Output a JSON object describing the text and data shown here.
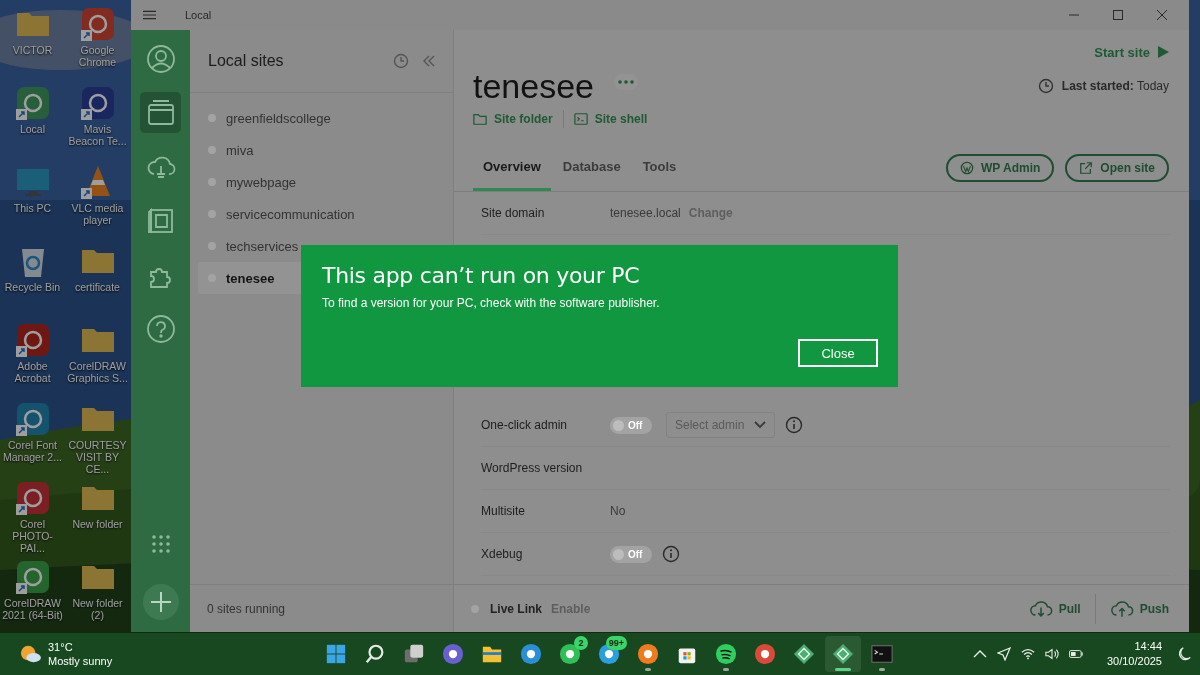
{
  "desktop_icons": [
    {
      "label": "VICTOR",
      "kind": "folder",
      "shortcut": false
    },
    {
      "label": "Google Chrome",
      "kind": "chrome",
      "shortcut": true
    },
    {
      "label": "Local",
      "kind": "local",
      "shortcut": true
    },
    {
      "label": "Mavis Beacon Te...",
      "kind": "mavis",
      "shortcut": true
    },
    {
      "label": "This PC",
      "kind": "monitor",
      "shortcut": false
    },
    {
      "label": "VLC media player",
      "kind": "vlc",
      "shortcut": true
    },
    {
      "label": "Recycle Bin",
      "kind": "recycle",
      "shortcut": false
    },
    {
      "label": "certificate",
      "kind": "folder",
      "shortcut": false
    },
    {
      "label": "Adobe Acrobat",
      "kind": "acrobat",
      "shortcut": true
    },
    {
      "label": "CorelDRAW Graphics S...",
      "kind": "folder",
      "shortcut": false
    },
    {
      "label": "Corel Font Manager 2...",
      "kind": "fontmgr",
      "shortcut": true
    },
    {
      "label": "COURTESY VISIT BY CE...",
      "kind": "folder",
      "shortcut": false
    },
    {
      "label": "Corel PHOTO-PAI...",
      "shortcut": true
    },
    {
      "label": "New folder",
      "kind": "folder",
      "shortcut": false
    },
    {
      "label": "CorelDRAW 2021 (64-Bit)",
      "kind": "draw",
      "shortcut": true
    },
    {
      "label": "New folder (2)",
      "kind": "folder",
      "shortcut": false
    }
  ],
  "window": {
    "title": "Local"
  },
  "nav": {
    "items": [
      {
        "kind": "account",
        "selected": false
      },
      {
        "kind": "sites",
        "selected": true
      },
      {
        "kind": "cloud",
        "selected": false
      },
      {
        "kind": "blueprints",
        "selected": false
      },
      {
        "kind": "addons",
        "selected": false
      },
      {
        "kind": "help",
        "selected": false
      }
    ]
  },
  "sites_panel": {
    "title": "Local sites",
    "sites": [
      {
        "name": "greenfieldscollege",
        "running": false,
        "selected": false
      },
      {
        "name": "miva",
        "running": false,
        "selected": false
      },
      {
        "name": "mywebpage",
        "running": false,
        "selected": false
      },
      {
        "name": "servicecommunication",
        "running": false,
        "selected": false
      },
      {
        "name": "techservices",
        "running": false,
        "selected": false
      },
      {
        "name": "tenesee",
        "running": false,
        "selected": true
      }
    ],
    "footer": "0 sites running"
  },
  "site": {
    "start_label": "Start site",
    "name": "tenesee",
    "last_started": "**Last started:** Today",
    "links": [
      {
        "kind": "folder",
        "label": "Site folder"
      },
      {
        "kind": "shell",
        "label": "Site shell"
      }
    ],
    "tabs": [
      {
        "label": "Overview",
        "selected": true
      },
      {
        "label": "Database",
        "selected": false
      },
      {
        "label": "Tools",
        "selected": false
      }
    ],
    "actions": [
      {
        "kind": "wordpress",
        "label": "WP Admin"
      },
      {
        "kind": "external",
        "label": "Open site"
      }
    ],
    "rows": [
      {
        "kind": "text",
        "label": "Site domain",
        "value": "tenesee.local",
        "link": "Change"
      },
      {
        "kind": "toggle",
        "label": "One-click admin",
        "on": false,
        "toggle_label": "Off",
        "select": "Select admin",
        "info": true
      },
      {
        "kind": "text",
        "label": "WordPress version"
      },
      {
        "kind": "text",
        "label": "Multisite",
        "value": "No"
      },
      {
        "kind": "toggle",
        "label": "Xdebug",
        "on": false,
        "toggle_label": "Off",
        "info": true
      }
    ],
    "live_link": {
      "label": "Live Link",
      "action": "Enable",
      "on": false
    },
    "sync": [
      {
        "kind": "pull",
        "label": "Pull"
      },
      {
        "kind": "push",
        "label": "Push"
      }
    ]
  },
  "dialog": {
    "title": "This app can’t run on your PC",
    "message": "To find a version for your PC, check with the software publisher.",
    "button": "Close"
  },
  "taskbar": {
    "weather": {
      "temp": "31°C",
      "condition": "Mostly sunny"
    },
    "apps": [
      {
        "kind": "start",
        "selected": false,
        "running": false
      },
      {
        "kind": "search",
        "selected": false,
        "running": false
      },
      {
        "kind": "taskview",
        "selected": false,
        "running": false
      },
      {
        "kind": "meet",
        "selected": false,
        "running": false
      },
      {
        "kind": "explorer",
        "selected": false,
        "running": false
      },
      {
        "kind": "edge",
        "selected": false,
        "running": false
      },
      {
        "kind": "whatsapp",
        "selected": false,
        "running": false,
        "badge": "2"
      },
      {
        "kind": "telegram",
        "selected": false,
        "running": false,
        "badge": "99+"
      },
      {
        "kind": "firefox",
        "selected": false,
        "running": true
      },
      {
        "kind": "store",
        "selected": false,
        "running": false
      },
      {
        "kind": "spotify",
        "selected": false,
        "running": true
      },
      {
        "kind": "chrome",
        "selected": false,
        "running": false
      },
      {
        "kind": "local",
        "selected": false,
        "running": false
      },
      {
        "kind": "local",
        "selected": true,
        "running": true
      },
      {
        "kind": "terminal",
        "selected": false,
        "running": true
      }
    ],
    "time": "14:44",
    "date": "30/10/2025"
  }
}
